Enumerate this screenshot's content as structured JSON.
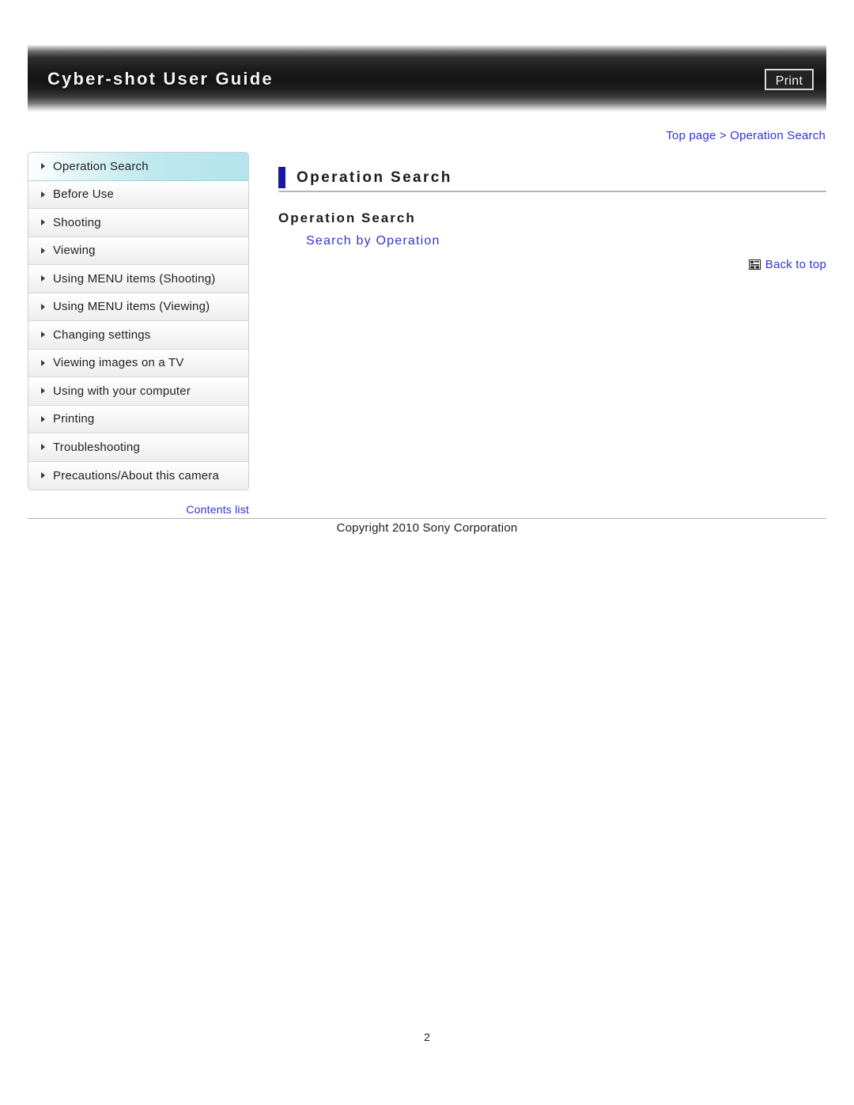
{
  "header": {
    "title": "Cyber-shot User Guide",
    "print_label": "Print"
  },
  "breadcrumb": {
    "text": "Top page > Operation Search"
  },
  "sidebar": {
    "items": [
      {
        "label": "Operation Search",
        "selected": true
      },
      {
        "label": "Before Use",
        "selected": false
      },
      {
        "label": "Shooting",
        "selected": false
      },
      {
        "label": "Viewing",
        "selected": false
      },
      {
        "label": "Using MENU items (Shooting)",
        "selected": false
      },
      {
        "label": "Using MENU items (Viewing)",
        "selected": false
      },
      {
        "label": "Changing settings",
        "selected": false
      },
      {
        "label": "Viewing images on a TV",
        "selected": false
      },
      {
        "label": "Using with your computer",
        "selected": false
      },
      {
        "label": "Printing",
        "selected": false
      },
      {
        "label": "Troubleshooting",
        "selected": false
      },
      {
        "label": "Precautions/About this camera",
        "selected": false
      }
    ],
    "contents_list_label": "Contents list"
  },
  "main": {
    "page_title": "Operation Search",
    "section_title": "Operation Search",
    "section_link": "Search by Operation",
    "back_to_top_label": "Back to top",
    "back_to_top_icon": "back-to-top-icon"
  },
  "footer": {
    "copyright": "Copyright 2010 Sony Corporation",
    "page_number": "2"
  },
  "colors": {
    "link": "#3333cc",
    "accent_bar": "#1a18a0",
    "selected_nav": "#bfe8ef",
    "banner_dark": "#141414"
  }
}
